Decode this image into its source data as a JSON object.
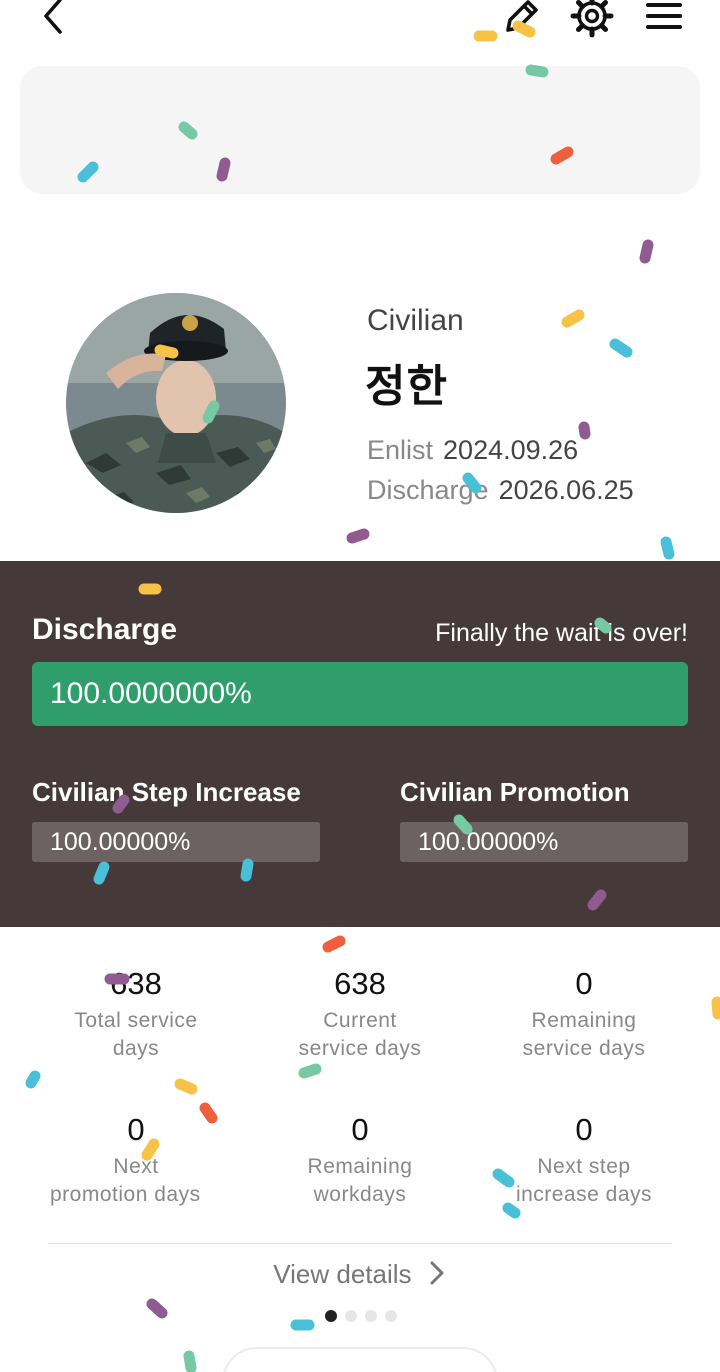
{
  "header": {
    "back_icon": "chevron-left-icon",
    "edit_icon": "pencil-icon",
    "settings_icon": "gear-icon",
    "menu_icon": "hamburger-menu-icon"
  },
  "profile": {
    "status": "Civilian",
    "name": "정한",
    "enlist_label": "Enlist",
    "enlist_date": "2024.09.26",
    "discharge_label": "Discharge",
    "discharge_date": "2026.06.25"
  },
  "progress": {
    "title": "Discharge",
    "subtitle": "Finally the wait is over!",
    "main_percent_text": "100.0000000%",
    "main_fraction": 1.0,
    "accent_color": "#2f9e6a",
    "step": {
      "title": "Civilian Step Increase",
      "percent_text": "100.00000%",
      "fraction": 1.0
    },
    "promotion": {
      "title": "Civilian Promotion",
      "percent_text": "100.00000%",
      "fraction": 1.0
    }
  },
  "stats": [
    {
      "value": "638",
      "label": "Total service days"
    },
    {
      "value": "638",
      "label": "Current service days"
    },
    {
      "value": "0",
      "label": "Remaining service days"
    },
    {
      "value": "0",
      "label": "Next promotion days"
    },
    {
      "value": "0",
      "label": "Remaining workdays"
    },
    {
      "value": "0",
      "label": "Next step increase days"
    }
  ],
  "view_details": "View details",
  "pagination": {
    "current": 1,
    "total": 4
  }
}
